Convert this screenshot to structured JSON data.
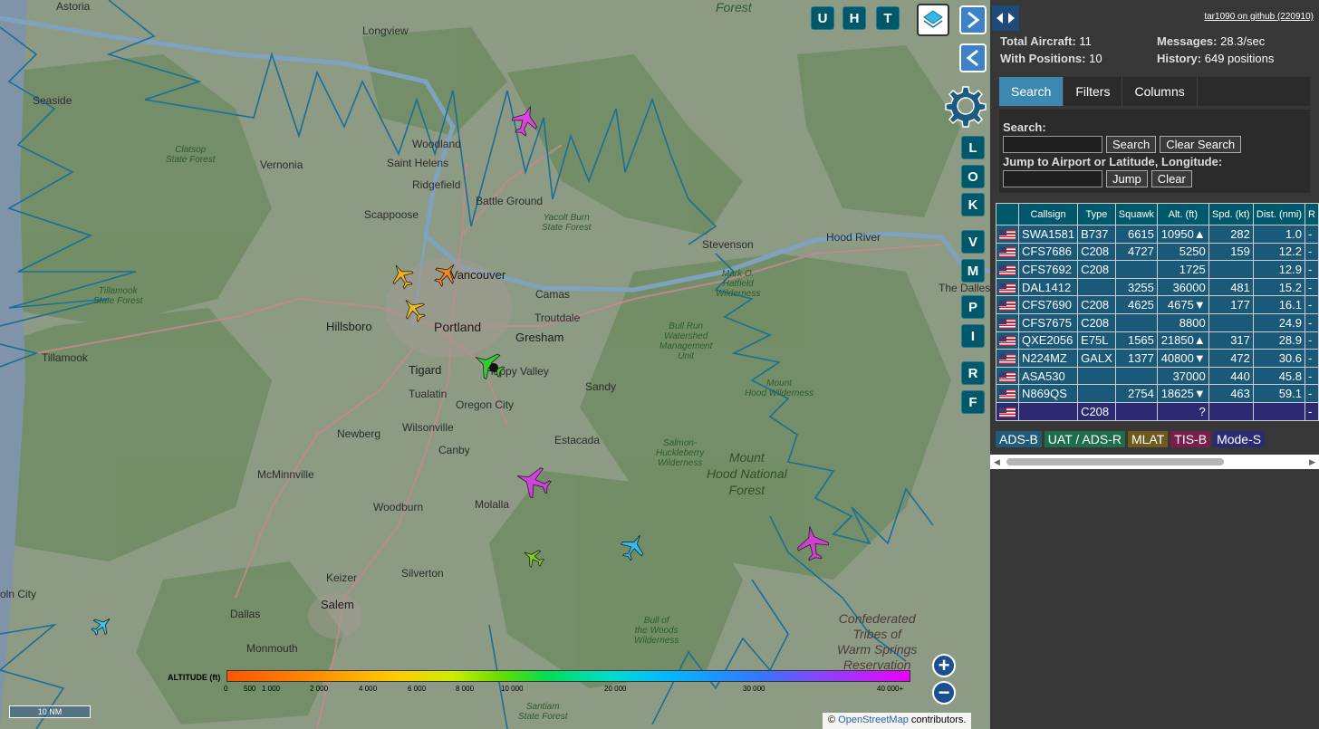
{
  "app": {
    "title": "tar1090",
    "github_link": "tar1090 on github (220910)"
  },
  "map": {
    "labels": {
      "astoria": "Astoria",
      "longview": "Longview",
      "seaside": "Seaside",
      "vernonia": "Vernonia",
      "clatsop": "Clatsop\nState Forest",
      "woodland": "Woodland",
      "saint_helens": "Saint Helens",
      "ridgefield": "Ridgefield",
      "battle_ground": "Battle Ground",
      "yacolt": "Yacolt Burn\nState Forest",
      "scappoose": "Scappoose",
      "vancouver": "Vancouver",
      "camas": "Camas",
      "stevenson": "Stevenson",
      "hood_river": "Hood River",
      "the_dalles": "The Dalles",
      "tillamook_sf": "Tillamook\nState Forest",
      "hillsboro": "Hillsboro",
      "portland": "Portland",
      "troutdale": "Troutdale",
      "gresham": "Gresham",
      "tillamook": "Tillamook",
      "tigard": "Tigard",
      "happy_valley": "Happy Valley",
      "tualatin": "Tualatin",
      "oregon_city": "Oregon City",
      "sandy": "Sandy",
      "wilsonville": "Wilsonville",
      "newberg": "Newberg",
      "canby": "Canby",
      "estacada": "Estacada",
      "mcminnville": "McMinnville",
      "woodburn": "Woodburn",
      "molalla": "Molalla",
      "silverton": "Silverton",
      "keizer": "Keizer",
      "salem": "Salem",
      "dallas": "Dallas",
      "monmouth": "Monmouth",
      "lincoln_city": "oln City",
      "hatfield": "Mark O.\nHatfield\nWilderness",
      "bull_run": "Bull Run\nWatershed\nManagement\nUnit",
      "mount_hood_wild": "Mount\nHood Wilderness",
      "salmon": "Salmon-\nHuckleberry\nWilderness",
      "mount_hood_nf": "Mount\nHood National\nForest",
      "bull_woods": "Bull of\nthe Woods\nWilderness",
      "warm_springs": "Confederated\nTribes of\nWarm Springs\nReservation",
      "santiam": "Santiam\nState Forest",
      "forest_top": "Forest"
    },
    "buttons": {
      "u": "U",
      "h": "H",
      "t": "T",
      "l": "L",
      "o": "O",
      "k": "K",
      "v": "V",
      "m": "M",
      "p": "P",
      "i": "I",
      "r": "R",
      "f": "F",
      "zoom_in": "+",
      "zoom_out": "−"
    },
    "altitude_legend": {
      "title": "ALTITUDE (ft)",
      "ticks": [
        "0",
        "500",
        "1 000",
        "2 000",
        "4 000",
        "6 000",
        "8 000",
        "10 000",
        "20 000",
        "30 000",
        "40 000+"
      ]
    },
    "scale_label": "10 NM",
    "attribution": {
      "symbol": "©",
      "link": "OpenStreetMap",
      "suffix": "contributors."
    }
  },
  "stats": {
    "total_label": "Total Aircraft:",
    "total_value": "11",
    "positions_label": "With Positions:",
    "positions_value": "10",
    "messages_label": "Messages:",
    "messages_value": "28.3/sec",
    "history_label": "History:",
    "history_value": "649 positions"
  },
  "tabs": [
    "Search",
    "Filters",
    "Columns"
  ],
  "search": {
    "search_label": "Search:",
    "search_button": "Search",
    "clear_search_button": "Clear Search",
    "jump_label": "Jump to Airport or Latitude, Longitude:",
    "jump_button": "Jump",
    "clear_button": "Clear"
  },
  "table": {
    "headers": [
      "",
      "Callsign",
      "Type",
      "Squawk",
      "Alt. (ft)",
      "Spd. (kt)",
      "Dist. (nmi)",
      "R"
    ],
    "rows": [
      {
        "callsign": "SWA1581",
        "type": "B737",
        "squawk": "6615",
        "alt": "10950▲",
        "spd": "282",
        "dist": "1.0",
        "extra": "-"
      },
      {
        "callsign": "CFS7686",
        "type": "C208",
        "squawk": "4727",
        "alt": "5250",
        "spd": "159",
        "dist": "12.2",
        "extra": "-"
      },
      {
        "callsign": "CFS7692",
        "type": "C208",
        "squawk": "",
        "alt": "1725",
        "spd": "",
        "dist": "12.9",
        "extra": "-"
      },
      {
        "callsign": "DAL1412",
        "type": "",
        "squawk": "3255",
        "alt": "36000",
        "spd": "481",
        "dist": "15.2",
        "extra": "-"
      },
      {
        "callsign": "CFS7690",
        "type": "C208",
        "squawk": "4625",
        "alt": "4675▼",
        "spd": "177",
        "dist": "16.1",
        "extra": "-"
      },
      {
        "callsign": "CFS7675",
        "type": "C208",
        "squawk": "",
        "alt": "8800",
        "spd": "",
        "dist": "24.9",
        "extra": "-"
      },
      {
        "callsign": "QXE2056",
        "type": "E75L",
        "squawk": "1565",
        "alt": "21850▲",
        "spd": "317",
        "dist": "28.9",
        "extra": "-"
      },
      {
        "callsign": "N224MZ",
        "type": "GALX",
        "squawk": "1377",
        "alt": "40800▼",
        "spd": "472",
        "dist": "30.6",
        "extra": "-"
      },
      {
        "callsign": "ASA530",
        "type": "",
        "squawk": "",
        "alt": "37000",
        "spd": "440",
        "dist": "45.8",
        "extra": "-"
      },
      {
        "callsign": "N869QS",
        "type": "",
        "squawk": "2754",
        "alt": "18625▼",
        "spd": "463",
        "dist": "59.1",
        "extra": "-"
      },
      {
        "callsign": "",
        "type": "C208",
        "squawk": "",
        "alt": "?",
        "spd": "",
        "dist": "",
        "extra": "-"
      }
    ]
  },
  "sources": [
    {
      "label": "ADS-B",
      "color": "#1f5b78"
    },
    {
      "label": "UAT / ADS-R",
      "color": "#1f6e4b"
    },
    {
      "label": "MLAT",
      "color": "#6e5a1f"
    },
    {
      "label": "TIS-B",
      "color": "#7a1f4b"
    },
    {
      "label": "Mode-S",
      "color": "#2b2a72"
    }
  ],
  "colors": {
    "accent": "#00596b",
    "table_row": "#1b5978",
    "tab_active": "#3d88b0",
    "track": "#1a6f96"
  }
}
